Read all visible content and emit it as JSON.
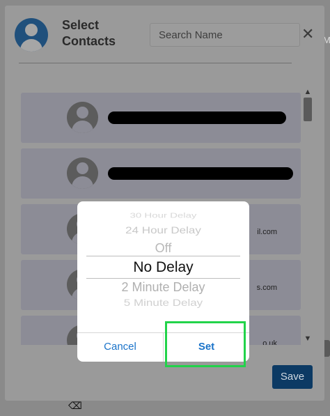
{
  "background": {
    "right_letter": "M",
    "eraser_icon": "eraser-icon"
  },
  "modal": {
    "title": "Select\nContacts",
    "search_placeholder": "Search Name",
    "close_icon": "close-icon",
    "save_label": "Save",
    "contacts": [
      {
        "email": ""
      },
      {
        "email": ""
      },
      {
        "email": "il.com"
      },
      {
        "email": "s.com"
      },
      {
        "email": "o.uk"
      }
    ]
  },
  "picker": {
    "options": [
      "30 Hour Delay",
      "24 Hour Delay",
      "Off",
      "No Delay",
      "2 Minute Delay",
      "5 Minute Delay"
    ],
    "selected": "No Delay",
    "cancel_label": "Cancel",
    "set_label": "Set"
  },
  "colors": {
    "accent": "#1a73c9",
    "highlight": "#22d34a",
    "save_button": "#0c3a64"
  }
}
